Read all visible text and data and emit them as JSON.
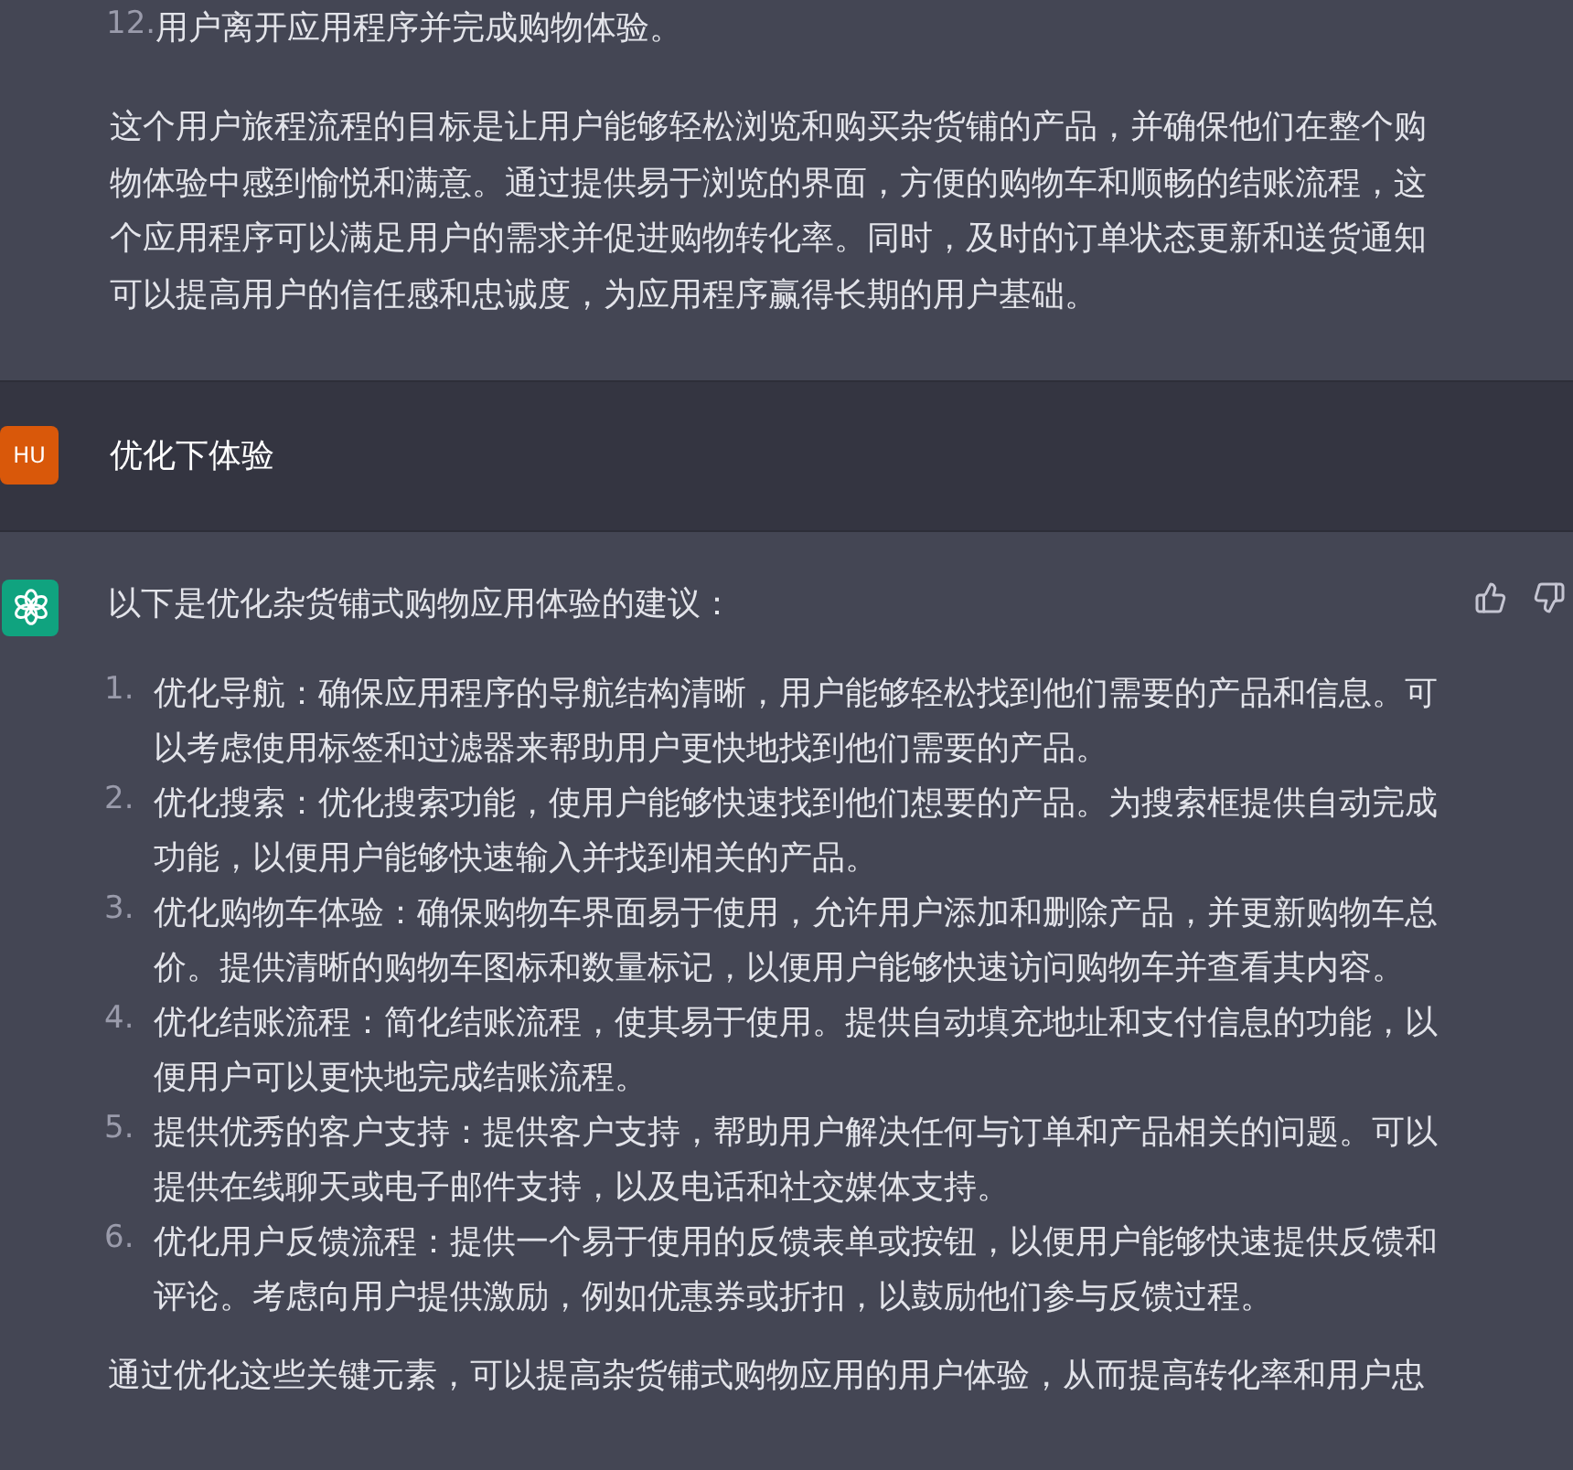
{
  "previous_response": {
    "list_tail": [
      {
        "number": "12.",
        "text": "用户离开应用程序并完成购物体验。"
      }
    ],
    "paragraph": "这个用户旅程流程的目标是让用户能够轻松浏览和购买杂货铺的产品，并确保他们在整个购物体验中感到愉悦和满意。通过提供易于浏览的界面，方便的购物车和顺畅的结账流程，这个应用程序可以满足用户的需求并促进购物转化率。同时，及时的订单状态更新和送货通知可以提高用户的信任感和忠诚度，为应用程序赢得长期的用户基础。"
  },
  "user_message": {
    "avatar": "HU",
    "text": "优化下体验"
  },
  "assistant_response": {
    "intro": "以下是优化杂货铺式购物应用体验的建议：",
    "list": [
      {
        "number": "1.",
        "text": "优化导航：确保应用程序的导航结构清晰，用户能够轻松找到他们需要的产品和信息。可以考虑使用标签和过滤器来帮助用户更快地找到他们需要的产品。"
      },
      {
        "number": "2.",
        "text": "优化搜索：优化搜索功能，使用户能够快速找到他们想要的产品。为搜索框提供自动完成功能，以便用户能够快速输入并找到相关的产品。"
      },
      {
        "number": "3.",
        "text": "优化购物车体验：确保购物车界面易于使用，允许用户添加和删除产品，并更新购物车总价。提供清晰的购物车图标和数量标记，以便用户能够快速访问购物车并查看其内容。"
      },
      {
        "number": "4.",
        "text": "优化结账流程：简化结账流程，使其易于使用。提供自动填充地址和支付信息的功能，以便用户可以更快地完成结账流程。"
      },
      {
        "number": "5.",
        "text": "提供优秀的客户支持：提供客户支持，帮助用户解决任何与订单和产品相关的问题。可以提供在线聊天或电子邮件支持，以及电话和社交媒体支持。"
      },
      {
        "number": "6.",
        "text": "优化用户反馈流程：提供一个易于使用的反馈表单或按钮，以便用户能够快速提供反馈和评论。考虑向用户提供激励，例如优惠券或折扣，以鼓励他们参与反馈过程。"
      }
    ],
    "closing": "通过优化这些关键元素，可以提高杂货铺式购物应用的用户体验，从而提高转化率和用户忠"
  }
}
